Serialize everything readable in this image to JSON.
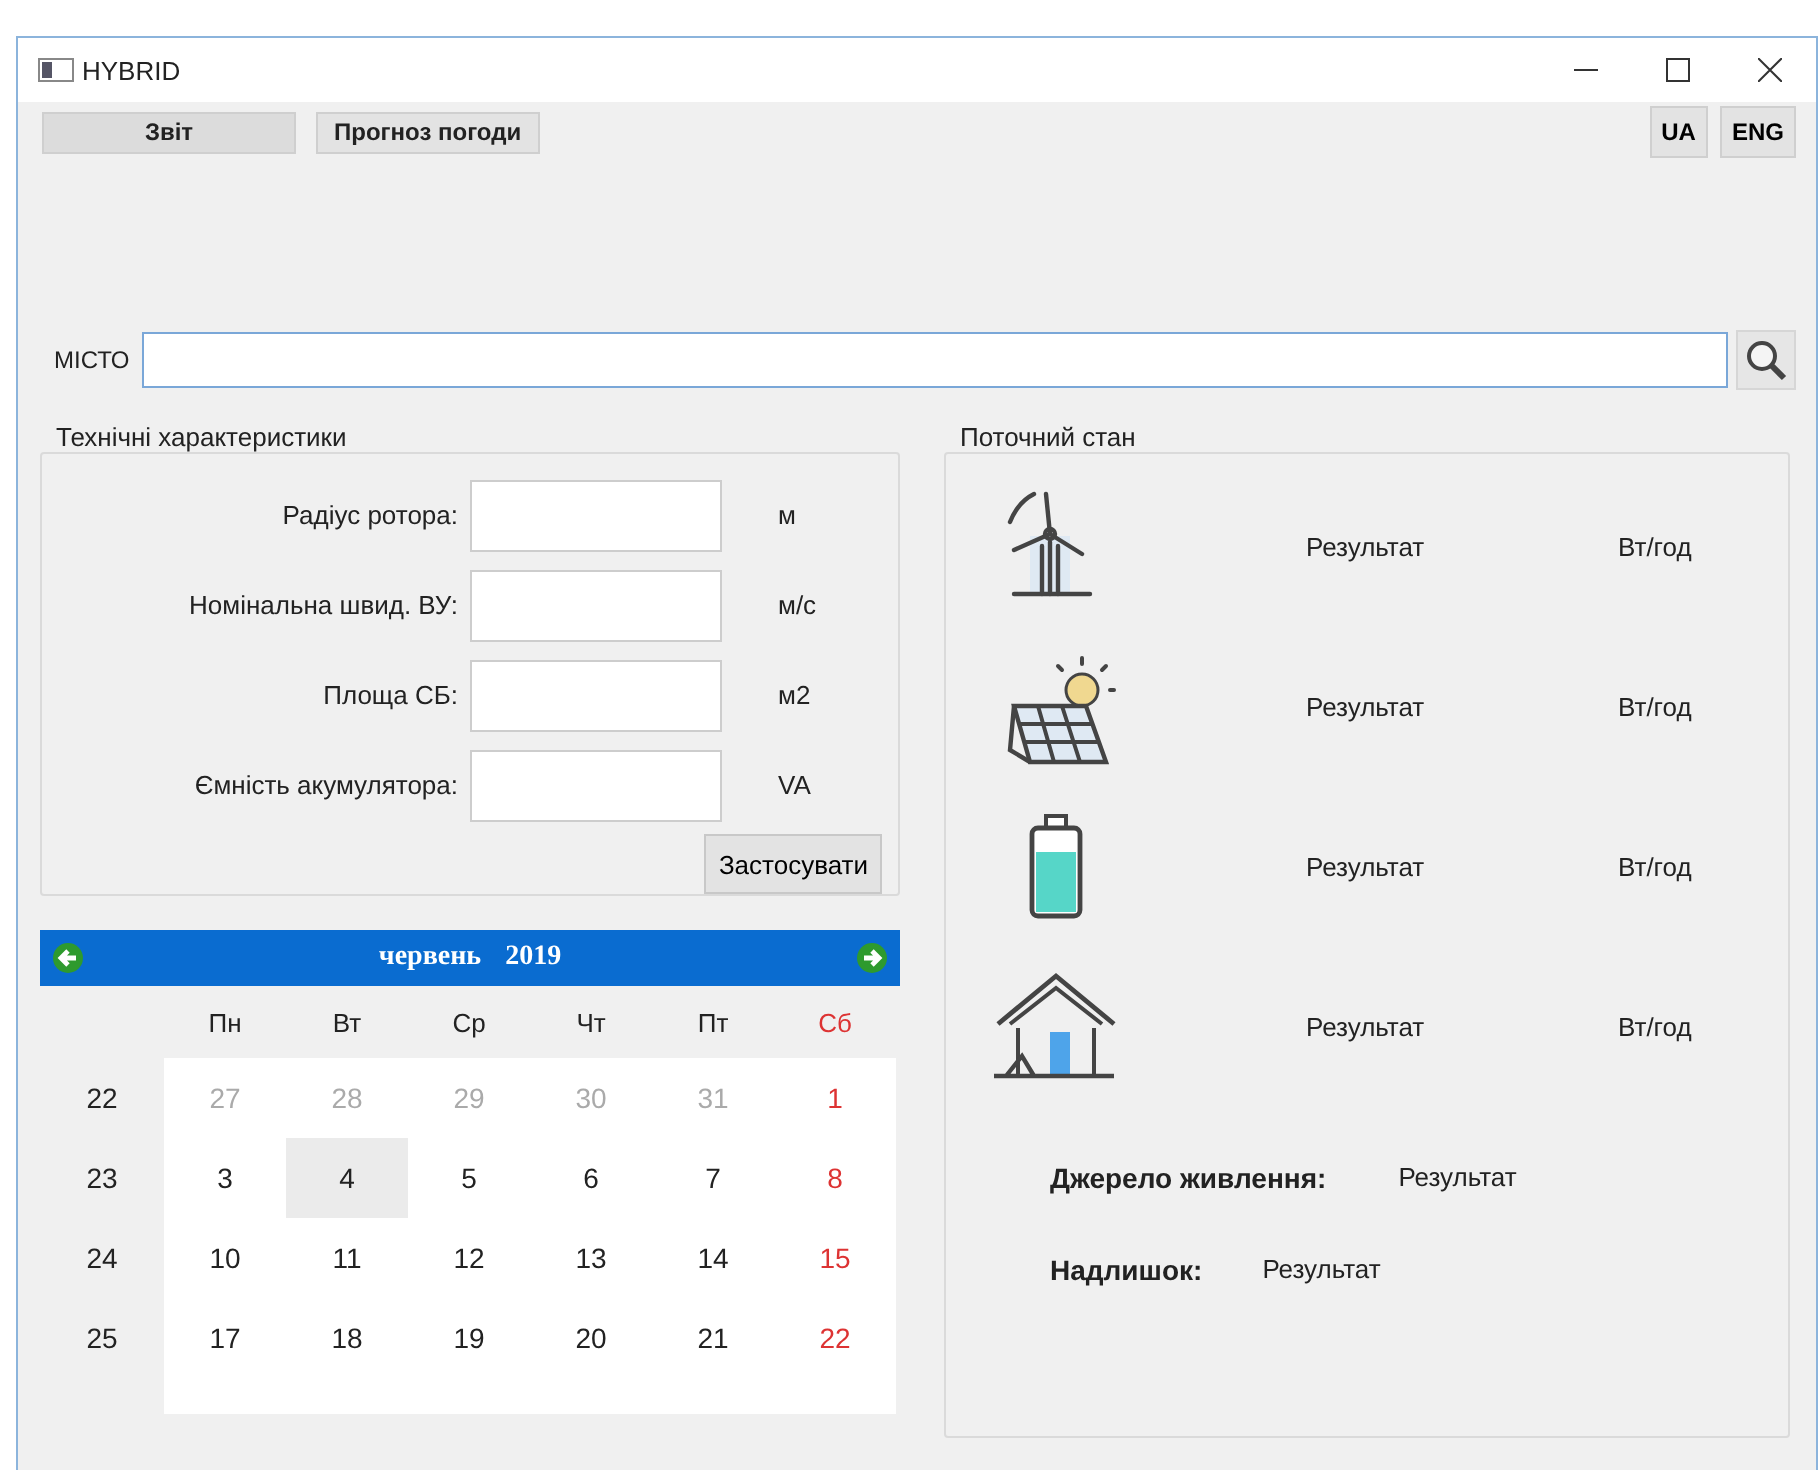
{
  "window": {
    "title": "HYBRID"
  },
  "toolbar": {
    "buttons": [
      {
        "label": "Звіт",
        "selected": true
      },
      {
        "label": "Прогноз погоди",
        "selected": false
      }
    ],
    "languages": [
      "UA",
      "ENG"
    ]
  },
  "city": {
    "label": "МІСТО"
  },
  "tech": {
    "title": "Технічні характеристики",
    "fields": [
      {
        "label": "Радіус ротора:",
        "unit": "м"
      },
      {
        "label": "Номінальна швид. ВУ:",
        "unit": "м/с"
      },
      {
        "label": "Площа СБ:",
        "unit": "м2"
      },
      {
        "label": "Ємність акумулятора:",
        "unit": "VA"
      }
    ],
    "apply": "Застосувати"
  },
  "calendar": {
    "month": "червень",
    "year": "2019",
    "weekdays": [
      {
        "label": "Пн",
        "weekend": false
      },
      {
        "label": "Вт",
        "weekend": false
      },
      {
        "label": "Ср",
        "weekend": false
      },
      {
        "label": "Чт",
        "weekend": false
      },
      {
        "label": "Пт",
        "weekend": false
      },
      {
        "label": "Сб",
        "weekend": true
      }
    ],
    "weeks": [
      {
        "number": "22",
        "days": [
          {
            "label": "27",
            "muted": true,
            "weekend": false,
            "selected": false
          },
          {
            "label": "28",
            "muted": true,
            "weekend": false,
            "selected": false
          },
          {
            "label": "29",
            "muted": true,
            "weekend": false,
            "selected": false
          },
          {
            "label": "30",
            "muted": true,
            "weekend": false,
            "selected": false
          },
          {
            "label": "31",
            "muted": true,
            "weekend": false,
            "selected": false
          },
          {
            "label": "1",
            "muted": false,
            "weekend": true,
            "selected": false
          }
        ]
      },
      {
        "number": "23",
        "days": [
          {
            "label": "3",
            "muted": false,
            "weekend": false,
            "selected": false
          },
          {
            "label": "4",
            "muted": false,
            "weekend": false,
            "selected": true
          },
          {
            "label": "5",
            "muted": false,
            "weekend": false,
            "selected": false
          },
          {
            "label": "6",
            "muted": false,
            "weekend": false,
            "selected": false
          },
          {
            "label": "7",
            "muted": false,
            "weekend": false,
            "selected": false
          },
          {
            "label": "8",
            "muted": false,
            "weekend": true,
            "selected": false
          }
        ]
      },
      {
        "number": "24",
        "days": [
          {
            "label": "10",
            "muted": false,
            "weekend": false,
            "selected": false
          },
          {
            "label": "11",
            "muted": false,
            "weekend": false,
            "selected": false
          },
          {
            "label": "12",
            "muted": false,
            "weekend": false,
            "selected": false
          },
          {
            "label": "13",
            "muted": false,
            "weekend": false,
            "selected": false
          },
          {
            "label": "14",
            "muted": false,
            "weekend": false,
            "selected": false
          },
          {
            "label": "15",
            "muted": false,
            "weekend": true,
            "selected": false
          }
        ]
      },
      {
        "number": "25",
        "days": [
          {
            "label": "17",
            "muted": false,
            "weekend": false,
            "selected": false
          },
          {
            "label": "18",
            "muted": false,
            "weekend": false,
            "selected": false
          },
          {
            "label": "19",
            "muted": false,
            "weekend": false,
            "selected": false
          },
          {
            "label": "20",
            "muted": false,
            "weekend": false,
            "selected": false
          },
          {
            "label": "21",
            "muted": false,
            "weekend": false,
            "selected": false
          },
          {
            "label": "22",
            "muted": false,
            "weekend": true,
            "selected": false
          }
        ]
      }
    ]
  },
  "status": {
    "title": "Поточний стан",
    "rows": [
      {
        "kind": "wind",
        "result": "Результат",
        "unit": "Вт/год"
      },
      {
        "kind": "solar",
        "result": "Результат",
        "unit": "Вт/год"
      },
      {
        "kind": "battery",
        "result": "Результат",
        "unit": "Вт/год"
      },
      {
        "kind": "home",
        "result": "Результат",
        "unit": "Вт/год"
      }
    ],
    "summary": [
      {
        "label": "Джерело живлення:",
        "value": "Результат"
      },
      {
        "label": "Надлишок:",
        "value": "Результат"
      }
    ]
  }
}
